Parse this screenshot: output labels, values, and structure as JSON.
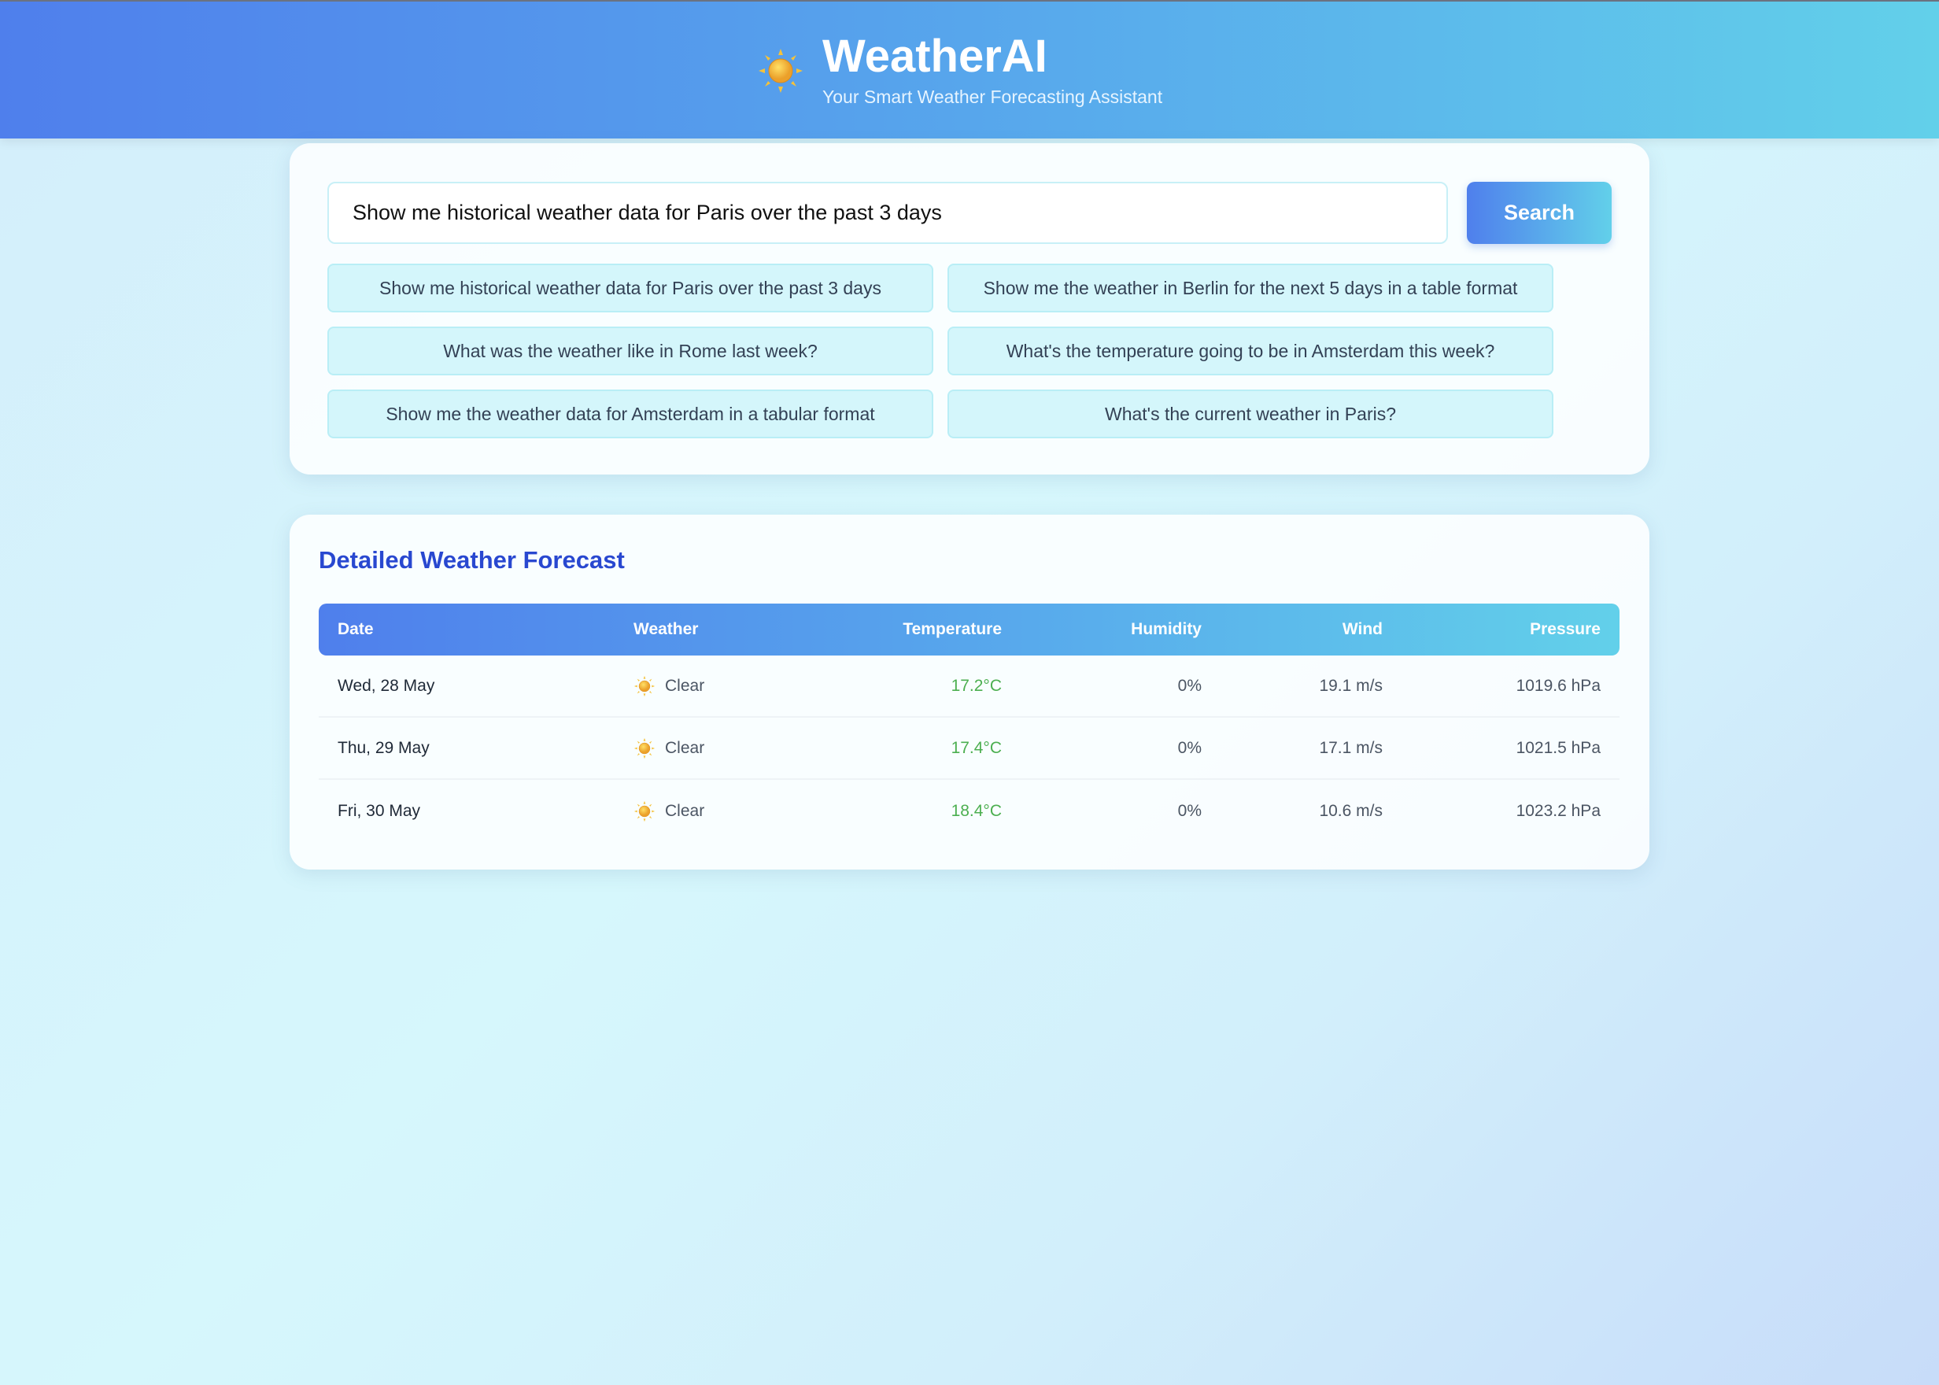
{
  "header": {
    "title": "WeatherAI",
    "subtitle": "Your Smart Weather Forecasting Assistant",
    "icon": "sun-icon"
  },
  "search": {
    "value": "Show me historical weather data for Paris over the past 3 days",
    "button": "Search"
  },
  "suggestions": [
    "Show me historical weather data for Paris over the past 3 days",
    "Show me the weather in Berlin for the next 5 days in a table format",
    "What was the weather like in Rome last week?",
    "What's the temperature going to be in Amsterdam this week?",
    "Show me the weather data for Amsterdam in a tabular format",
    "What's the current weather in Paris?"
  ],
  "forecast": {
    "title": "Detailed Weather Forecast",
    "columns": [
      "Date",
      "Weather",
      "Temperature",
      "Humidity",
      "Wind",
      "Pressure"
    ],
    "rows": [
      {
        "date": "Wed, 28 May",
        "weather": "Clear",
        "temp": "17.2°C",
        "humidity": "0%",
        "wind": "19.1 m/s",
        "pressure": "1019.6 hPa"
      },
      {
        "date": "Thu, 29 May",
        "weather": "Clear",
        "temp": "17.4°C",
        "humidity": "0%",
        "wind": "17.1 m/s",
        "pressure": "1021.5 hPa"
      },
      {
        "date": "Fri, 30 May",
        "weather": "Clear",
        "temp": "18.4°C",
        "humidity": "0%",
        "wind": "10.6 m/s",
        "pressure": "1023.2 hPa"
      }
    ]
  },
  "colors": {
    "accent": "#4f7fec",
    "accent2": "#62d0ea",
    "title": "#2948d0",
    "temp": "#4caf50"
  }
}
